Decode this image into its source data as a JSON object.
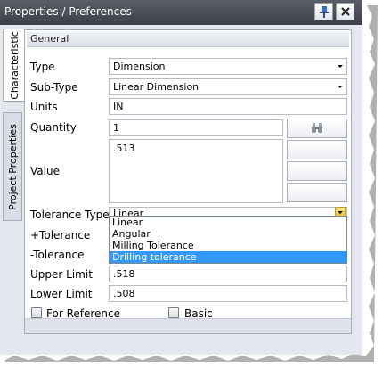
{
  "window": {
    "title": "Properties / Preferences"
  },
  "titlebar_icons": [
    "pin-icon",
    "close-icon"
  ],
  "vertical_tabs": [
    {
      "label": "Characteristic",
      "active": true
    },
    {
      "label": "Project Properties",
      "active": false
    }
  ],
  "group": {
    "header": "General"
  },
  "fields": {
    "type": {
      "label": "Type",
      "value": "Dimension"
    },
    "subtype": {
      "label": "Sub-Type",
      "value": "Linear Dimension"
    },
    "units": {
      "label": "Units",
      "value": "IN"
    },
    "quantity": {
      "label": "Quantity",
      "value": "1"
    },
    "value": {
      "label": "Value",
      "value": ".513"
    },
    "tolerance_type": {
      "label": "Tolerance Type",
      "value": "Linear",
      "options": [
        "Linear",
        "Angular",
        "Milling Tolerance",
        "Drilling tolerance"
      ],
      "highlighted": "Drilling tolerance"
    },
    "plus_tolerance": {
      "label": "+Tolerance"
    },
    "minus_tolerance": {
      "label": "-Tolerance"
    },
    "upper_limit": {
      "label": "Upper Limit",
      "value": ".518"
    },
    "lower_limit": {
      "label": "Lower Limit",
      "value": ".508"
    }
  },
  "checkboxes": {
    "for_reference": {
      "label": "For Reference",
      "checked": false
    },
    "basic": {
      "label": "Basic",
      "checked": false
    }
  },
  "colors": {
    "titlebar": "#4a4e55",
    "selection": "#3399ff",
    "dropdown_button": "#f2c12e"
  }
}
